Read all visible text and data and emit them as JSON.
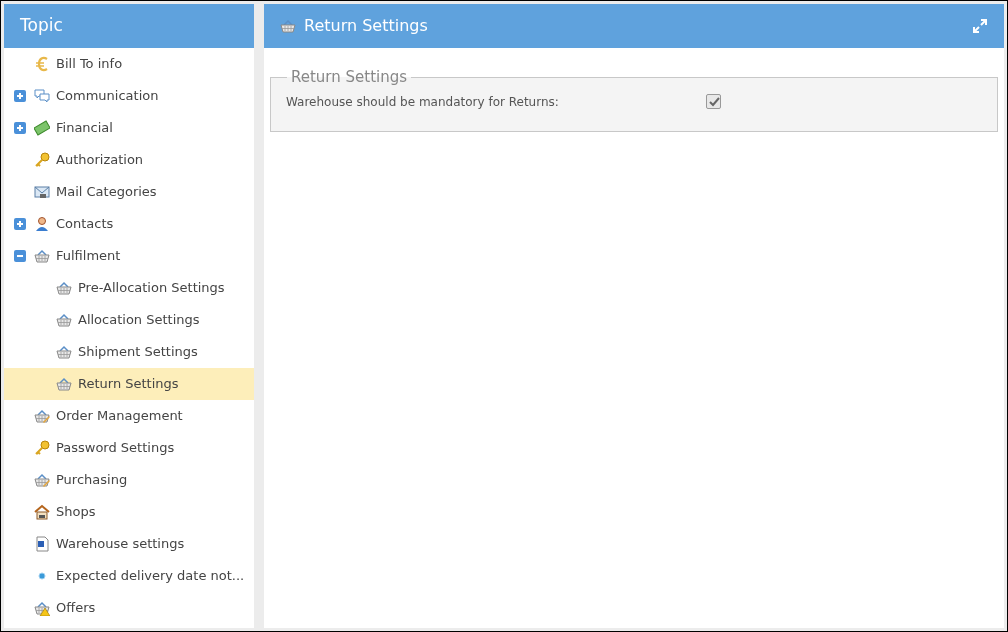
{
  "sidebar": {
    "title": "Topic",
    "items": [
      {
        "label": "Bill To info",
        "kind": "euro",
        "selected": false
      },
      {
        "label": "Communication",
        "kind": "chat",
        "expanded": false,
        "selected": false
      },
      {
        "label": "Financial",
        "kind": "money",
        "expanded": false,
        "selected": false
      },
      {
        "label": "Authorization",
        "kind": "key",
        "selected": false
      },
      {
        "label": "Mail Categories",
        "kind": "mail",
        "selected": false
      },
      {
        "label": "Contacts",
        "kind": "person",
        "expanded": false,
        "selected": false
      },
      {
        "label": "Fulfilment",
        "kind": "basket",
        "expanded": true,
        "selected": false,
        "children": [
          {
            "label": "Pre-Allocation Settings",
            "kind": "basket",
            "selected": false
          },
          {
            "label": "Allocation Settings",
            "kind": "basket",
            "selected": false
          },
          {
            "label": "Shipment Settings",
            "kind": "basket",
            "selected": false
          },
          {
            "label": "Return Settings",
            "kind": "basket",
            "selected": true
          }
        ]
      },
      {
        "label": "Order Management",
        "kind": "order",
        "selected": false
      },
      {
        "label": "Password Settings",
        "kind": "key",
        "selected": false
      },
      {
        "label": "Purchasing",
        "kind": "order",
        "selected": false
      },
      {
        "label": "Shops",
        "kind": "house",
        "selected": false
      },
      {
        "label": "Warehouse settings",
        "kind": "document",
        "selected": false
      },
      {
        "label": "Expected delivery date not...",
        "kind": "dot",
        "selected": false
      },
      {
        "label": "Offers",
        "kind": "offer",
        "selected": false
      }
    ]
  },
  "panel": {
    "title": "Return Settings",
    "group": {
      "legend": "Return Settings",
      "fields": [
        {
          "label": "Warehouse should be mandatory for Returns:",
          "checked": true
        }
      ]
    }
  }
}
